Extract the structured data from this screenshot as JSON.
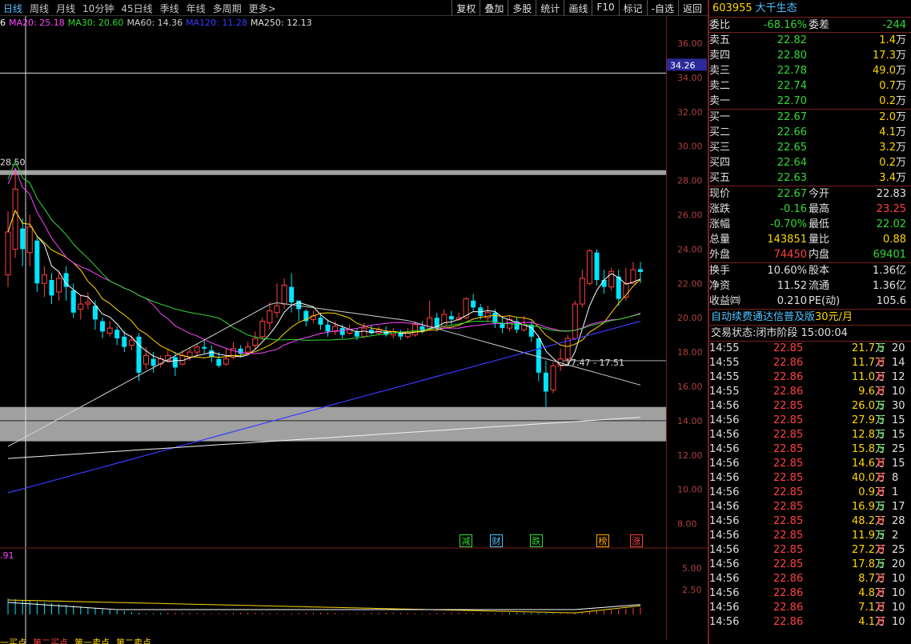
{
  "topbar": {
    "periods": [
      "日线",
      "周线",
      "月线",
      "10分钟",
      "45日线",
      "季线",
      "年线",
      "多周期",
      "更多>"
    ],
    "active_period": "日线",
    "tools": [
      "复权",
      "叠加",
      "多股",
      "统计",
      "画线",
      "F10",
      "标记",
      "-自选",
      "返回"
    ]
  },
  "ma_legend": [
    {
      "label": "6",
      "color": "#ffffff"
    },
    {
      "label": "MA20: 25.18",
      "color": "#ff44ff"
    },
    {
      "label": "MA30: 20.60",
      "color": "#33d933"
    },
    {
      "label": "MA60: 14.36",
      "color": "#cfcfcf"
    },
    {
      "label": "MA120: 11.28",
      "color": "#3a3aff"
    },
    {
      "label": "MA250: 12.13",
      "color": "#e0e0e0"
    }
  ],
  "price_axis": [
    "36.00",
    "34.00",
    "32.00",
    "30.00",
    "28.00",
    "26.00",
    "24.00",
    "22.00",
    "20.00",
    "18.00",
    "16.00",
    "14.00",
    "12.00",
    "10.00",
    "8.00"
  ],
  "price_tag": "34.26",
  "high_label": "28.50",
  "low_label": "17.47 - 17.51",
  "sub_axis": [
    "5.00",
    "2.50"
  ],
  "sub_value": ".91",
  "events": [
    {
      "label": "减",
      "color": "#33d933"
    },
    {
      "label": "财",
      "color": "#4fc3ff"
    },
    {
      "label": "跌",
      "color": "#33d933"
    },
    {
      "label": "榜",
      "color": "#ffa500"
    },
    {
      "label": "涨",
      "color": "#ff4040"
    }
  ],
  "bottom_tabs": [
    "一买点",
    "第二买点",
    "第一卖点",
    "第二卖点"
  ],
  "quote": {
    "code": "603955",
    "name": "大千生态",
    "weibi_label": "委比",
    "weibi": "-68.16%",
    "weicha_label": "委差",
    "weicha": "-244",
    "asks": [
      {
        "label": "卖五",
        "price": "22.82",
        "vol": "1.4",
        "unit": "万"
      },
      {
        "label": "卖四",
        "price": "22.80",
        "vol": "17.3",
        "unit": "万"
      },
      {
        "label": "卖三",
        "price": "22.78",
        "vol": "49.0",
        "unit": "万"
      },
      {
        "label": "卖二",
        "price": "22.74",
        "vol": "0.7",
        "unit": "万"
      },
      {
        "label": "卖一",
        "price": "22.70",
        "vol": "0.2",
        "unit": "万"
      }
    ],
    "bids": [
      {
        "label": "买一",
        "price": "22.67",
        "vol": "2.0",
        "unit": "万"
      },
      {
        "label": "买二",
        "price": "22.66",
        "vol": "4.1",
        "unit": "万"
      },
      {
        "label": "买三",
        "price": "22.65",
        "vol": "3.2",
        "unit": "万"
      },
      {
        "label": "买四",
        "price": "22.64",
        "vol": "0.2",
        "unit": "万"
      },
      {
        "label": "买五",
        "price": "22.63",
        "vol": "3.4",
        "unit": "万"
      }
    ],
    "stats1": [
      {
        "l1": "现价",
        "v1": "22.67",
        "c1": "green",
        "l2": "今开",
        "v2": "22.83",
        "c2": "white"
      },
      {
        "l1": "涨跌",
        "v1": "-0.16",
        "c1": "green",
        "l2": "最高",
        "v2": "23.25",
        "c2": "red"
      },
      {
        "l1": "涨幅",
        "v1": "-0.70%",
        "c1": "green",
        "l2": "最低",
        "v2": "22.02",
        "c2": "green"
      },
      {
        "l1": "总量",
        "v1": "143851",
        "c1": "yellow",
        "l2": "量比",
        "v2": "0.88",
        "c2": "yellow"
      },
      {
        "l1": "外盘",
        "v1": "74450",
        "c1": "red",
        "l2": "内盘",
        "v2": "69401",
        "c2": "green"
      }
    ],
    "stats2": [
      {
        "l1": "换手",
        "v1": "10.60%",
        "c1": "white",
        "l2": "股本",
        "v2": "1.36亿",
        "c2": "white"
      },
      {
        "l1": "净资",
        "v1": "11.52",
        "c1": "white",
        "l2": "流通",
        "v2": "1.36亿",
        "c2": "white"
      },
      {
        "l1": "收益㈣",
        "v1": "0.210",
        "c1": "white",
        "l2": "PE(动)",
        "v2": "105.6",
        "c2": "white"
      }
    ],
    "fee_text": "自动续费通达信普及版",
    "fee_price": "30元/月",
    "state_text": "交易状态:闭市阶段 15:00:04"
  },
  "ticks": [
    {
      "t": "14:55",
      "p": "22.85",
      "v": "21.7",
      "bs": "S",
      "n": "20"
    },
    {
      "t": "14:55",
      "p": "22.86",
      "v": "11.7",
      "bs": "B",
      "n": "14"
    },
    {
      "t": "14:55",
      "p": "22.86",
      "v": "11.0",
      "bs": "B",
      "n": "12"
    },
    {
      "t": "14:55",
      "p": "22.86",
      "v": "9.6",
      "bs": "B",
      "n": "10"
    },
    {
      "t": "14:56",
      "p": "22.85",
      "v": "26.0",
      "bs": "S",
      "n": "30"
    },
    {
      "t": "14:56",
      "p": "22.85",
      "v": "27.9",
      "bs": "S",
      "n": "15"
    },
    {
      "t": "14:56",
      "p": "22.85",
      "v": "12.8",
      "bs": "S",
      "n": "15"
    },
    {
      "t": "14:56",
      "p": "22.85",
      "v": "15.8",
      "bs": "S",
      "n": "25"
    },
    {
      "t": "14:56",
      "p": "22.85",
      "v": "14.6",
      "bs": "B",
      "n": "15"
    },
    {
      "t": "14:56",
      "p": "22.85",
      "v": "40.0",
      "bs": "B",
      "n": "8"
    },
    {
      "t": "14:56",
      "p": "22.85",
      "v": "0.9",
      "bs": "B",
      "n": "1"
    },
    {
      "t": "14:56",
      "p": "22.85",
      "v": "16.9",
      "bs": "S",
      "n": "17"
    },
    {
      "t": "14:56",
      "p": "22.85",
      "v": "48.2",
      "bs": "B",
      "n": "28"
    },
    {
      "t": "14:56",
      "p": "22.85",
      "v": "11.9",
      "bs": "S",
      "n": "2"
    },
    {
      "t": "14:56",
      "p": "22.85",
      "v": "27.2",
      "bs": "B",
      "n": "25"
    },
    {
      "t": "14:56",
      "p": "22.85",
      "v": "17.8",
      "bs": "S",
      "n": "20"
    },
    {
      "t": "14:56",
      "p": "22.86",
      "v": "8.7",
      "bs": "B",
      "n": "10"
    },
    {
      "t": "14:56",
      "p": "22.86",
      "v": "4.8",
      "bs": "B",
      "n": "10"
    },
    {
      "t": "14:56",
      "p": "22.86",
      "v": "7.1",
      "bs": "B",
      "n": "10"
    },
    {
      "t": "14:56",
      "p": "22.86",
      "v": "4.1",
      "bs": "B",
      "n": "10"
    }
  ],
  "tick_unit": "万"
}
